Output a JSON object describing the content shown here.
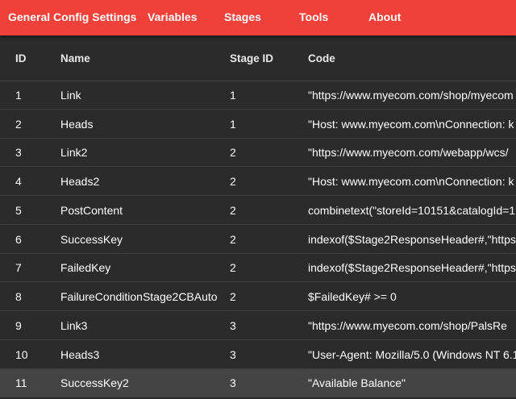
{
  "menu": {
    "items": [
      {
        "label": "General Config Settings"
      },
      {
        "label": "Variables"
      },
      {
        "label": "Stages"
      },
      {
        "label": "Tools"
      },
      {
        "label": "About"
      }
    ]
  },
  "table": {
    "columns": [
      "ID",
      "Name",
      "Stage ID",
      "Code"
    ],
    "rows": [
      {
        "id": "1",
        "name": "Link",
        "stage": "1",
        "code": "\"https://www.myecom.com/shop/myecom"
      },
      {
        "id": "2",
        "name": "Heads",
        "stage": "1",
        "code": "\"Host: www.myecom.com\\nConnection: k"
      },
      {
        "id": "3",
        "name": "Link2",
        "stage": "2",
        "code": "\"https://www.myecom.com/webapp/wcs/"
      },
      {
        "id": "4",
        "name": "Heads2",
        "stage": "2",
        "code": "\"Host: www.myecom.com\\nConnection: k"
      },
      {
        "id": "5",
        "name": "PostContent",
        "stage": "2",
        "code": "combinetext(\"storeId=10151&catalogId=1"
      },
      {
        "id": "6",
        "name": "SuccessKey",
        "stage": "2",
        "code": "indexof($Stage2ResponseHeader#,\"https:"
      },
      {
        "id": "7",
        "name": "FailedKey",
        "stage": "2",
        "code": "indexof($Stage2ResponseHeader#,\"https:"
      },
      {
        "id": "8",
        "name": "FailureConditionStage2CBAuto",
        "stage": "2",
        "code": "$FailedKey# >= 0"
      },
      {
        "id": "9",
        "name": "Link3",
        "stage": "3",
        "code": "\"https://www.myecom.com/shop/PalsRe"
      },
      {
        "id": "10",
        "name": "Heads3",
        "stage": "3",
        "code": "\"User-Agent: Mozilla/5.0 (Windows NT 6.1"
      },
      {
        "id": "11",
        "name": "SuccessKey2",
        "stage": "3",
        "code": "\"Available Balance\""
      }
    ],
    "selected_row": "11"
  },
  "colors": {
    "menubar": "#f0403a",
    "background": "#2b2b2b",
    "selected_row": "#444444",
    "text": "#ffffff"
  }
}
